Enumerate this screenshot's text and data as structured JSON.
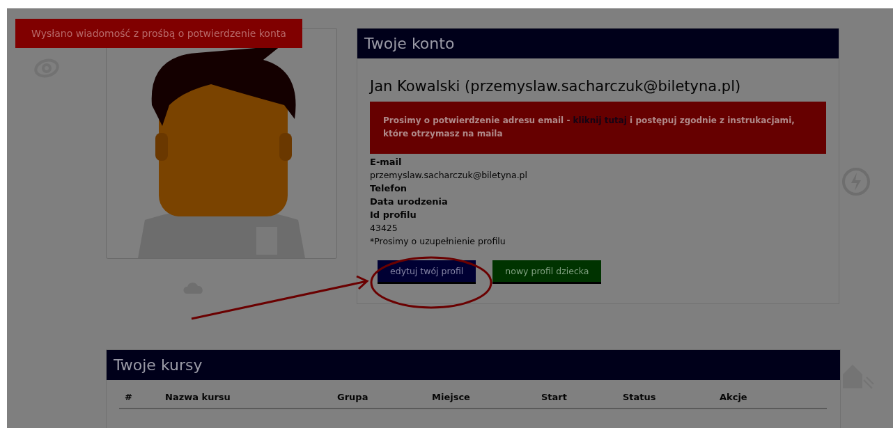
{
  "toast": {
    "text": "Wysłano wiadomość z prośbą o potwierdzenie konta"
  },
  "account": {
    "title": "Twoje konto",
    "name": "Jan Kowalski (przemyslaw.sacharczuk@biletyna.pl)",
    "alert": {
      "before": "Prosimy o potwierdzenie adresu email - ",
      "link": "kliknij tutaj",
      "after": " i postępuj zgodnie z instrukacjami, które otrzymasz na maila"
    },
    "details": [
      {
        "kind": "label",
        "text": "E-mail"
      },
      {
        "kind": "value",
        "text": "przemyslaw.sacharczuk@biletyna.pl"
      },
      {
        "kind": "label",
        "text": "Telefon"
      },
      {
        "kind": "label",
        "text": "Data urodzenia"
      },
      {
        "kind": "label",
        "text": "Id profilu"
      },
      {
        "kind": "value",
        "text": "43425"
      },
      {
        "kind": "value",
        "text": "*Prosimy o uzupełnienie profilu"
      }
    ],
    "buttons": [
      {
        "kind": "edit",
        "label": "edytuj twój profil"
      },
      {
        "kind": "child",
        "label": "nowy profil dziecka"
      }
    ]
  },
  "courses": {
    "title": "Twoje kursy",
    "columns": [
      "#",
      "Nazwa kursu",
      "Grupa",
      "Miejsce",
      "Start",
      "Status",
      "Akcje"
    ]
  }
}
